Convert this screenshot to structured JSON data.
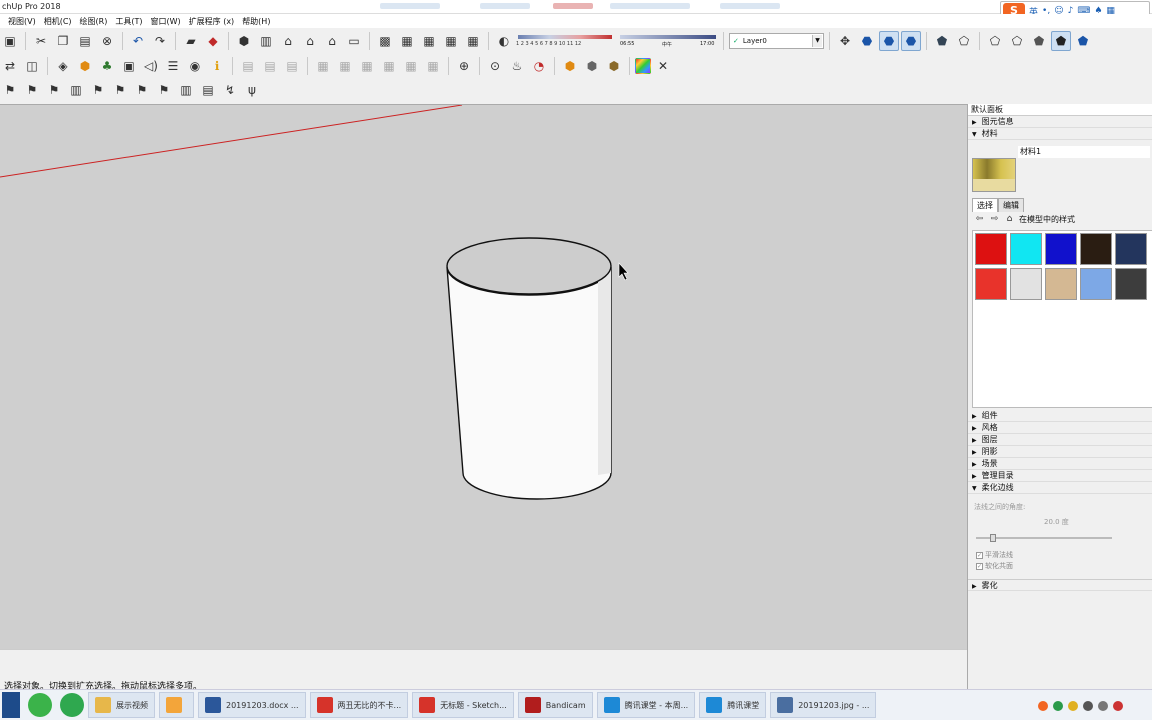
{
  "window": {
    "title": "chUp Pro 2018"
  },
  "ime": {
    "lang": "英",
    "logo": "S"
  },
  "menu": [
    "视图(V)",
    "相机(C)",
    "绘图(R)",
    "工具(T)",
    "窗口(W)",
    "扩展程序 (x)",
    "帮助(H)"
  ],
  "toolbar": {
    "scale_ticks": "1 2 3 4 5 6 7 8 9 10 11 12",
    "time_left": "06:55",
    "time_mid": "中午",
    "time_right": "17:00",
    "layer": "Layer0"
  },
  "status": {
    "message": "选择对象。切换到扩充选择。拖动鼠标选择多项。"
  },
  "tray": {
    "title": "默认面板",
    "sections_top": [
      "图元信息",
      "材料"
    ],
    "material_name": "材料1",
    "tabs": [
      "选择",
      "编辑"
    ],
    "library": "在模型中的样式",
    "swatches": [
      {
        "color": "#dd1111"
      },
      {
        "color": "#11e6f2"
      },
      {
        "color": "#1111cc"
      },
      {
        "color": "#2a1d12"
      },
      {
        "color": "#23355d"
      },
      {
        "color": "#e8332b"
      },
      {
        "color": "#e2e2e2"
      },
      {
        "color": "#d4b893"
      },
      {
        "color": "#7da8e6"
      },
      {
        "color": "#3d3d3d"
      }
    ],
    "sections_bottom": [
      "组件",
      "风格",
      "图层",
      "阴影",
      "场景",
      "管理目录",
      "柔化边线"
    ],
    "soften_label": "法线之间的角度:",
    "soften_angle": "20.0 度",
    "smooth_normals": "平滑法线",
    "soften_coplanar": "软化共面",
    "fog": "雾化"
  },
  "taskbar": {
    "items": [
      {
        "label": "展示视频",
        "color": "#e7b74a"
      },
      {
        "label": "",
        "color": "#f3a53a"
      },
      {
        "label": "20191203.docx ...",
        "color": "#2b579a"
      },
      {
        "label": "两丑无比的不卡...",
        "color": "#d6332a"
      },
      {
        "label": "无标题 - Sketch...",
        "color": "#d6332a"
      },
      {
        "label": "Bandicam",
        "color": "#b11d1d"
      },
      {
        "label": "腾讯课堂 - 本周...",
        "color": "#1d89d6"
      },
      {
        "label": "腾讯课堂",
        "color": "#1d89d6"
      },
      {
        "label": "20191203.jpg - ...",
        "color": "#4a6ea0"
      }
    ]
  }
}
